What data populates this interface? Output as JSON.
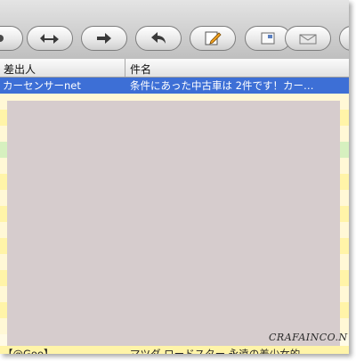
{
  "toolbar": {
    "buttons": [
      {
        "icon": "reply-all-icon"
      },
      {
        "icon": "forward-icon"
      },
      {
        "icon": "reply-icon"
      },
      {
        "icon": "compose-icon"
      },
      {
        "icon": "note-icon"
      },
      {
        "icon": "mailbox-icon"
      }
    ]
  },
  "columns": {
    "sender": "差出人",
    "subject": "件名"
  },
  "messages": [
    {
      "sender": "カーセンサーnet",
      "subject": "条件にあった中古車は 2件です！カー…",
      "state": "selected"
    },
    {
      "sender": "【@Goo】",
      "subject": "マツダ ロードスター 永遠の差少女的…",
      "state": "plain"
    }
  ],
  "watermark": "CRAFAINCO.N",
  "colors": {
    "selection": "#3d6fd6",
    "row_highlight": "#fff4a8",
    "row_green": "#d6f0bf",
    "overlay": "#d6cccd"
  }
}
